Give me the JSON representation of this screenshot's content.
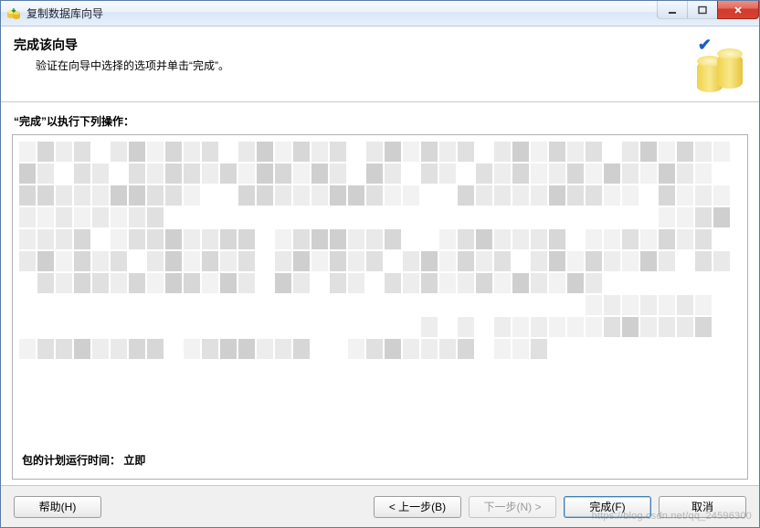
{
  "window": {
    "title": "复制数据库向导"
  },
  "header": {
    "heading": "完成该向导",
    "subheading": "验证在向导中选择的选项并单击“完成”。"
  },
  "content": {
    "instruction_prefix": "“完成”以执行下列操作：",
    "schedule_line": "包的计划运行时间： 立即"
  },
  "buttons": {
    "help": "帮助(H)",
    "back": "< 上一步(B)",
    "next": "下一步(N) >",
    "finish": "完成(F)",
    "cancel": "取消"
  },
  "watermark": "https://blog.csdn.net/qq_24596300"
}
